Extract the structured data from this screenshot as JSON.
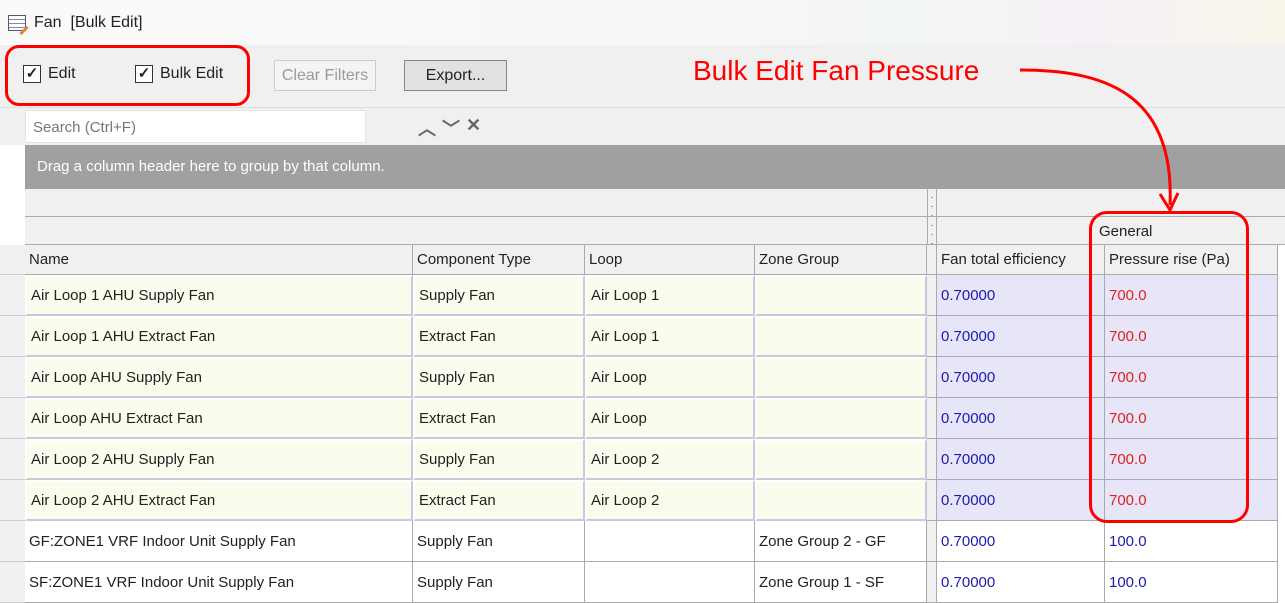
{
  "window": {
    "title": "Fan  [Bulk Edit]",
    "icon": "table-edit-icon"
  },
  "toolbar": {
    "edit_label": "Edit",
    "edit_checked": true,
    "bulk_edit_label": "Bulk Edit",
    "bulk_edit_checked": true,
    "clear_filters_label": "Clear Filters",
    "export_label": "Export..."
  },
  "search": {
    "placeholder": "Search (Ctrl+F)",
    "up": "︿",
    "down": "﹀",
    "close": "✕"
  },
  "group_panel": {
    "text": "Drag a column header here to group by that column."
  },
  "band": {
    "general": "General"
  },
  "columns": [
    "Name",
    "Component Type",
    "Loop",
    "Zone Group",
    "Fan total efficiency",
    "Pressure rise (Pa)"
  ],
  "rows": [
    [
      "Air Loop 1 AHU Supply Fan",
      "Supply Fan",
      "Air Loop 1",
      "",
      "0.70000",
      "700.0"
    ],
    [
      "Air Loop 1 AHU Extract Fan",
      "Extract Fan",
      "Air Loop 1",
      "",
      "0.70000",
      "700.0"
    ],
    [
      "Air Loop AHU Supply Fan",
      "Supply Fan",
      "Air Loop",
      "",
      "0.70000",
      "700.0"
    ],
    [
      "Air Loop AHU Extract Fan",
      "Extract Fan",
      "Air Loop",
      "",
      "0.70000",
      "700.0"
    ],
    [
      "Air Loop 2 AHU Supply Fan",
      "Supply Fan",
      "Air Loop 2",
      "",
      "0.70000",
      "700.0"
    ],
    [
      "Air Loop 2 AHU Extract Fan",
      "Extract Fan",
      "Air Loop 2",
      "",
      "0.70000",
      "700.0"
    ],
    [
      "GF:ZONE1 VRF Indoor Unit Supply Fan",
      "Supply Fan",
      "",
      "Zone Group 2 - GF",
      "0.70000",
      "100.0"
    ],
    [
      "SF:ZONE1 VRF Indoor Unit Supply Fan",
      "Supply Fan",
      "",
      "Zone Group 1 - SF",
      "0.70000",
      "100.0"
    ]
  ],
  "annotation": {
    "text": "Bulk Edit Fan Pressure",
    "color": "#ff0000"
  },
  "colors": {
    "edited_value": "#e02020",
    "value": "#1a1ab0",
    "edited_text_cell": "#fcfcee",
    "edited_num_cell": "#e6e6f8"
  }
}
